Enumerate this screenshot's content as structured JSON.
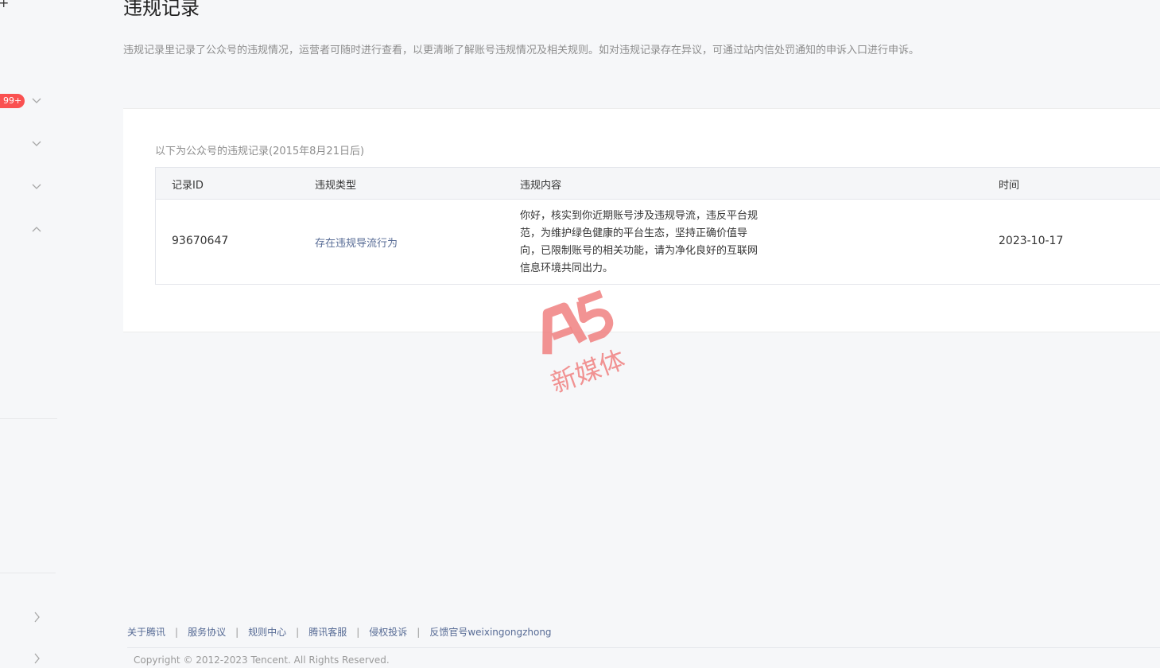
{
  "page": {
    "title": "违规记录",
    "description": "违规记录里记录了公众号的违规情况，运营者可随时进行查看，以更清晰了解账号违规情况及相关规则。如对违规记录存在异议，可通过站内信处罚通知的申诉入口进行申诉。"
  },
  "sidebar": {
    "badge": "99+",
    "accent": "#fa5151"
  },
  "card": {
    "caption": "以下为公众号的违规记录(2015年8月21日后)"
  },
  "table": {
    "headers": {
      "id": "记录ID",
      "type": "违规类型",
      "content": "违规内容",
      "time": "时间"
    },
    "rows": [
      {
        "id": "93670647",
        "type": "存在违规导流行为",
        "content": "你好，核实到你近期账号涉及违规导流，违反平台规范，为维护绿色健康的平台生态，坚持正确价值导向，已限制账号的相关功能，请为净化良好的互联网信息环境共同出力。",
        "time": "2023-10-17"
      }
    ]
  },
  "watermark": {
    "logo": "A5",
    "text": "新媒体"
  },
  "footer": {
    "links": [
      "关于腾讯",
      "服务协议",
      "规则中心",
      "腾讯客服",
      "侵权投诉",
      "反馈官号weixingongzhong"
    ],
    "copyright": "Copyright © 2012-2023 Tencent. All Rights Reserved."
  }
}
